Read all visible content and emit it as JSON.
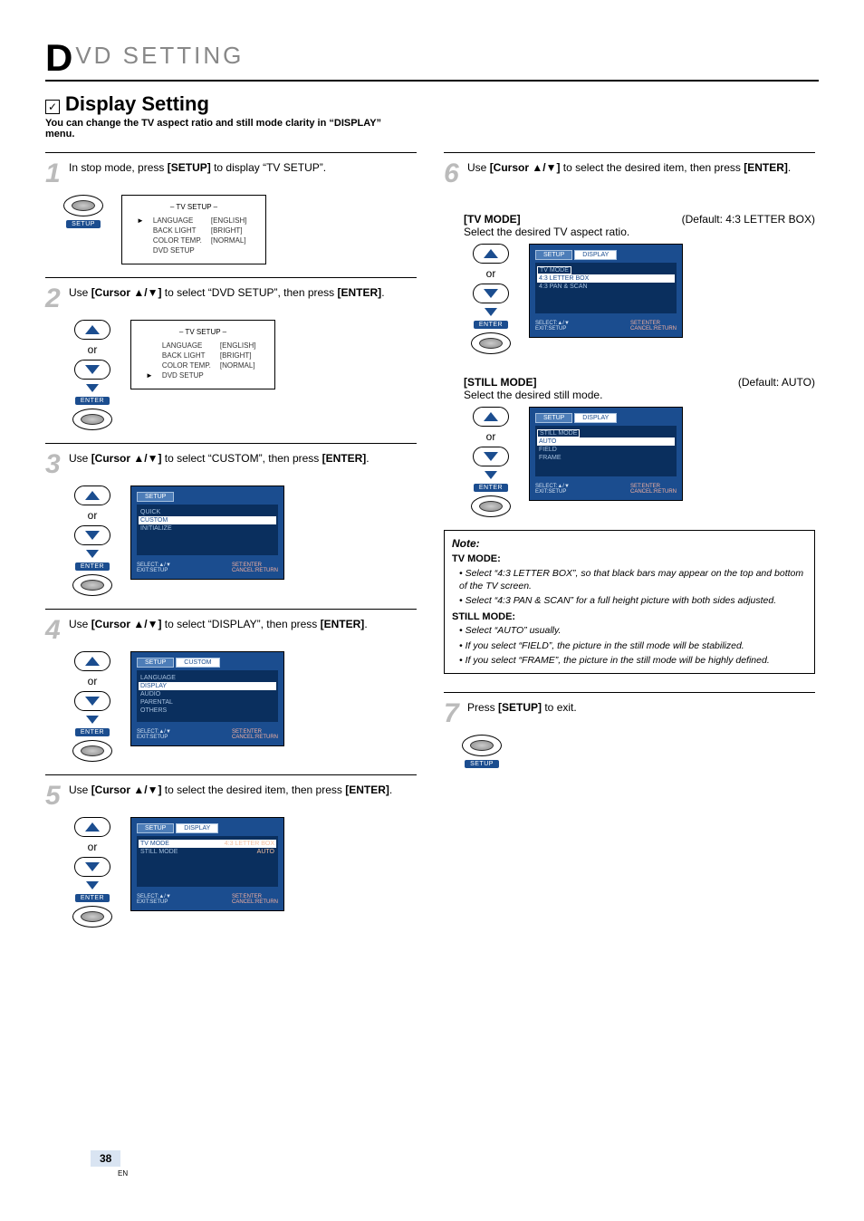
{
  "header": {
    "prefix": "D",
    "rest": "VD SETTING"
  },
  "title": {
    "checkbox": "✓",
    "text": "Display Setting"
  },
  "intro": "You can change the TV aspect ratio and still mode clarity in “DISPLAY” menu.",
  "remote": {
    "or": "or",
    "enter": "ENTER",
    "setup": "SETUP"
  },
  "osd_tv_setup": {
    "title": "– TV SETUP –",
    "rows": [
      {
        "label": "LANGUAGE",
        "val": "[ENGLISH]",
        "ptr": "►"
      },
      {
        "label": "BACK LIGHT",
        "val": "[BRIGHT]",
        "ptr": ""
      },
      {
        "label": "COLOR TEMP.",
        "val": "[NORMAL]",
        "ptr": ""
      },
      {
        "label": "DVD SETUP",
        "val": "",
        "ptr": ""
      }
    ]
  },
  "osd_tv_setup2": {
    "title": "– TV SETUP –",
    "rows": [
      {
        "label": "LANGUAGE",
        "val": "[ENGLISH]",
        "ptr": ""
      },
      {
        "label": "BACK LIGHT",
        "val": "[BRIGHT]",
        "ptr": ""
      },
      {
        "label": "COLOR TEMP.",
        "val": "[NORMAL]",
        "ptr": ""
      },
      {
        "label": "DVD SETUP",
        "val": "",
        "ptr": "►"
      }
    ]
  },
  "osd_setup_menu": {
    "tab": "SETUP",
    "items": [
      "QUICK",
      "CUSTOM",
      "INITIALIZE"
    ],
    "highlight": 1,
    "footer": {
      "l1": "SELECT:▲/▼",
      "r1": "SET:ENTER",
      "l2": "EXIT:SETUP",
      "r2": "CANCEL:RETURN"
    }
  },
  "osd_custom_menu": {
    "tabs": [
      "SETUP",
      "CUSTOM"
    ],
    "items": [
      "LANGUAGE",
      "DISPLAY",
      "AUDIO",
      "PARENTAL",
      "OTHERS"
    ],
    "highlight": 1,
    "footer": {
      "l1": "SELECT:▲/▼",
      "r1": "SET:ENTER",
      "l2": "EXIT:SETUP",
      "r2": "CANCEL:RETURN"
    }
  },
  "osd_display_menu": {
    "tabs": [
      "SETUP",
      "DISPLAY"
    ],
    "items": [
      {
        "label": "TV MODE",
        "val": "4:3 LETTER BOX",
        "hl": true
      },
      {
        "label": "STILL MODE",
        "val": "AUTO",
        "hl": false
      }
    ],
    "footer": {
      "l1": "SELECT:▲/▼",
      "r1": "SET:ENTER",
      "l2": "EXIT:SETUP",
      "r2": "CANCEL:RETURN"
    }
  },
  "osd_tvmode_sub": {
    "tabs": [
      "SETUP",
      "DISPLAY"
    ],
    "header": "TV MODE",
    "items": [
      "4:3 LETTER BOX",
      "4:3 PAN & SCAN"
    ],
    "highlight": 0,
    "footer": {
      "l1": "SELECT:▲/▼",
      "r1": "SET:ENTER",
      "l2": "EXIT:SETUP",
      "r2": "CANCEL:RETURN"
    }
  },
  "osd_stillmode_sub": {
    "tabs": [
      "SETUP",
      "DISPLAY"
    ],
    "header": "STILL MODE",
    "items": [
      "AUTO",
      "FIELD",
      "FRAME"
    ],
    "highlight": 0,
    "footer": {
      "l1": "SELECT:▲/▼",
      "r1": "SET:ENTER",
      "l2": "EXIT:SETUP",
      "r2": "CANCEL:RETURN"
    }
  },
  "steps": {
    "s1": {
      "n": "1",
      "pre": "In stop mode, press ",
      "bold": "[SETUP]",
      "post": " to display “TV SETUP”."
    },
    "s2": {
      "n": "2",
      "pre": "Use ",
      "bold": "[Cursor ▲/▼]",
      "mid": " to select “DVD SETUP”, then press ",
      "bold2": "[ENTER]",
      "post2": "."
    },
    "s3": {
      "n": "3",
      "pre": "Use ",
      "bold": "[Cursor ▲/▼]",
      "mid": " to select “CUSTOM”, then press ",
      "bold2": "[ENTER]",
      "post2": "."
    },
    "s4": {
      "n": "4",
      "pre": "Use ",
      "bold": "[Cursor ▲/▼]",
      "mid": " to select “DISPLAY”, then press ",
      "bold2": "[ENTER]",
      "post2": "."
    },
    "s5": {
      "n": "5",
      "pre": "Use ",
      "bold": "[Cursor ▲/▼]",
      "mid": " to select the desired item, then press ",
      "bold2": "[ENTER]",
      "post2": "."
    },
    "s6": {
      "n": "6",
      "pre": "Use ",
      "bold": "[Cursor ▲/▼]",
      "mid": " to select the desired item, then press ",
      "bold2": "[ENTER]",
      "post2": "."
    },
    "s7": {
      "n": "7",
      "pre": "Press ",
      "bold": "[SETUP]",
      "post": " to exit."
    }
  },
  "tvmode": {
    "label": "[TV MODE]",
    "default": "(Default: 4:3 LETTER BOX)",
    "desc": "Select the desired TV aspect ratio."
  },
  "stillmode": {
    "label": "[STILL MODE]",
    "default": "(Default: AUTO)",
    "desc": "Select the desired still mode."
  },
  "note": {
    "title": "Note:",
    "tv_label": "TV MODE:",
    "tv_items": [
      "Select “4:3 LETTER BOX”, so that black bars may appear on the top and bottom of the TV screen.",
      "Select “4:3 PAN & SCAN” for a full height picture with both sides adjusted."
    ],
    "still_label": "STILL MODE:",
    "still_items": [
      "Select “AUTO” usually.",
      "If you select “FIELD”, the picture in the still mode will be stabilized.",
      "If you select “FRAME”, the picture in the still mode will be highly defined."
    ]
  },
  "page": {
    "num": "38",
    "en": "EN"
  }
}
